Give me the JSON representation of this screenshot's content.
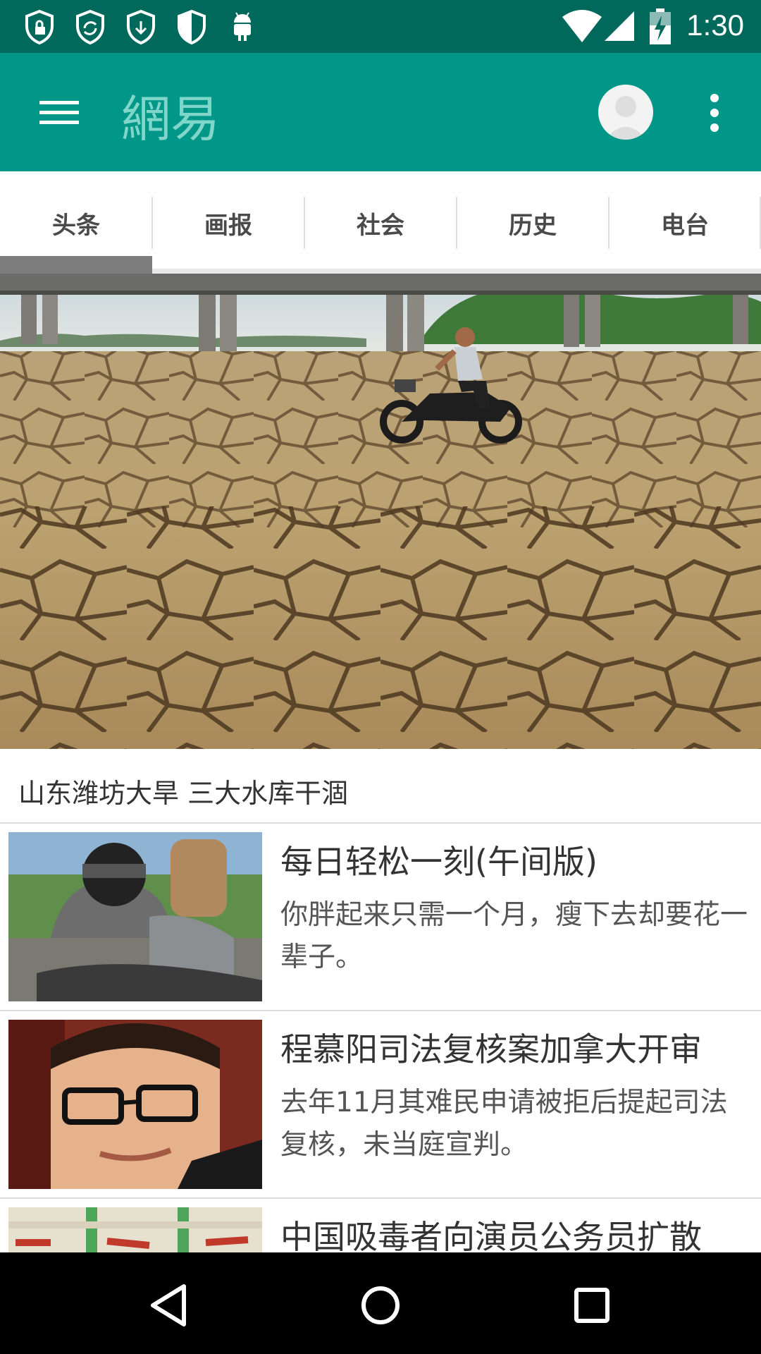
{
  "status_bar": {
    "time": "1:30",
    "left_icons": [
      "shield-lock-icon",
      "shield-sync-icon",
      "shield-download-icon",
      "shield-half-icon",
      "android-icon"
    ],
    "right_icons": [
      "wifi-icon",
      "cell-signal-icon",
      "battery-charging-icon"
    ],
    "background": "#00695c"
  },
  "app_bar": {
    "logo_text": "網易",
    "background": "#009688"
  },
  "tabs": [
    {
      "label": "头条",
      "selected": true
    },
    {
      "label": "画报",
      "selected": false
    },
    {
      "label": "社会",
      "selected": false
    },
    {
      "label": "历史",
      "selected": false
    },
    {
      "label": "电台",
      "selected": false
    }
  ],
  "hero": {
    "caption": "山东潍坊大旱 三大水库干涸"
  },
  "news": [
    {
      "title": "每日轻松一刻(午间版)",
      "desc": "你胖起来只需一个月，瘦下去却要花一辈子。"
    },
    {
      "title": "程慕阳司法复核案加拿大开审",
      "desc": "去年11月其难民申请被拒后提起司法复核，未当庭宣判。"
    },
    {
      "title": "中国吸毒者向演员公务员扩散",
      "desc": ""
    }
  ]
}
